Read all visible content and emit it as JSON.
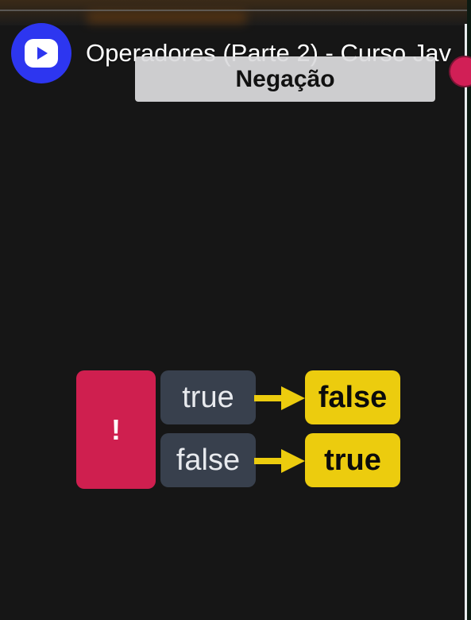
{
  "video": {
    "title": "Operadores (Parte 2) - Curso Jav",
    "section_label": "Negação"
  },
  "icons": {
    "channel_logo": "play-icon",
    "record_indicator": "record-dot"
  },
  "diagram": {
    "operator": "!",
    "rows": [
      {
        "input": "true",
        "output": "false"
      },
      {
        "input": "false",
        "output": "true"
      }
    ],
    "colors": {
      "operator_box": "#cf1f4f",
      "input_box": "#38404d",
      "output_box": "#eccc0e",
      "arrow": "#eccc0e",
      "logo": "#2d36f0"
    }
  }
}
